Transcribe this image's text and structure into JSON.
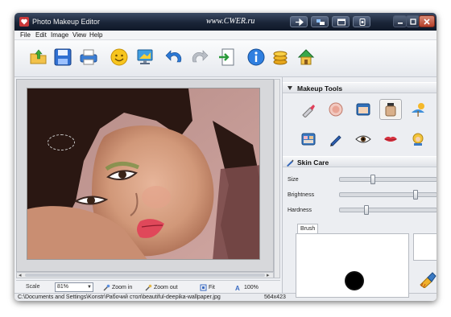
{
  "window": {
    "title": "Photo Makeup Editor",
    "watermark": "www.CWER.ru"
  },
  "menu": [
    "File",
    "Edit",
    "Image",
    "View",
    "Help"
  ],
  "toolbar": [
    "open",
    "save",
    "print",
    "smile",
    "monitor",
    "undo",
    "redo",
    "export",
    "info",
    "coins",
    "home"
  ],
  "makeup": {
    "title": "Makeup Tools",
    "tools": [
      "lipstick-tool",
      "powder-tool",
      "compact-tool",
      "foundation-tool",
      "beach-tool",
      "palette-tool",
      "eyeliner-tool",
      "eye-tool",
      "lips-tool",
      "hair-tool"
    ],
    "selected_index": 3
  },
  "skin": {
    "title": "Skin Care",
    "size_label": "Size",
    "brightness_label": "Brightness",
    "hardness_label": "Hardness",
    "size": 0.33,
    "brightness": 0.8,
    "hardness": 0.26
  },
  "brush": {
    "tab_label": "Brush",
    "color": "#ffffff"
  },
  "bottom": {
    "scale_label": "Scale",
    "scale_value": "81%",
    "zoom_in": "Zoom in",
    "zoom_out": "Zoom out",
    "fit": "Fit",
    "hundred": "100%"
  },
  "status": {
    "path": "C:\\Documents and Settings\\Konstr\\Рабочий стол\\beautiful-deepika-wallpaper.jpg",
    "dims": "564x423"
  },
  "colors": {
    "accent": "#3b6cc2",
    "title_dark": "#1a2538"
  }
}
